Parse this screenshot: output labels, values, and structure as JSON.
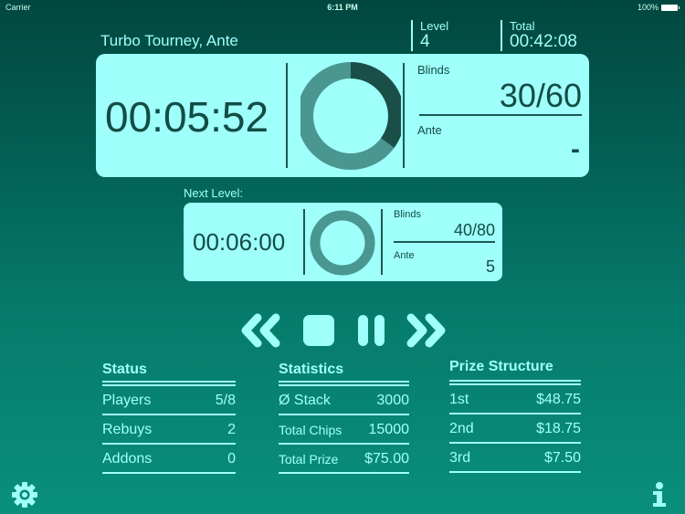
{
  "statusbar": {
    "carrier": "Carrier",
    "time": "6:11 PM",
    "battery": "100%"
  },
  "header": {
    "title": "Turbo Tourney, Ante",
    "level_label": "Level",
    "level_value": "4",
    "total_label": "Total",
    "total_value": "00:42:08"
  },
  "current": {
    "timer": "00:05:52",
    "progress_elapsed": 0.35,
    "blinds_label": "Blinds",
    "blinds_value": "30/60",
    "ante_label": "Ante",
    "ante_value": "-"
  },
  "next": {
    "label": "Next Level:",
    "timer": "00:06:00",
    "progress_elapsed": 0,
    "blinds_label": "Blinds",
    "blinds_value": "40/80",
    "ante_label": "Ante",
    "ante_value": "5"
  },
  "controls": {
    "rewind": "rewind-icon",
    "stop": "stop-icon",
    "pause": "pause-icon",
    "forward": "fast-forward-icon"
  },
  "status": {
    "title": "Status",
    "rows": [
      {
        "label": "Players",
        "value": "5/8"
      },
      {
        "label": "Rebuys",
        "value": "2"
      },
      {
        "label": "Addons",
        "value": "0"
      }
    ]
  },
  "statistics": {
    "title": "Statistics",
    "rows": [
      {
        "label": "Ø Stack",
        "value": "3000"
      },
      {
        "label": "Total Chips",
        "value": "15000"
      },
      {
        "label": "Total Prize",
        "value": "$75.00"
      }
    ]
  },
  "prize": {
    "title": "Prize Structure",
    "rows": [
      {
        "label": "1st",
        "value": "$48.75"
      },
      {
        "label": "2nd",
        "value": "$18.75"
      },
      {
        "label": "3rd",
        "value": "$7.50"
      }
    ]
  },
  "colors": {
    "accent": "#9ffffb",
    "dark": "#124d45",
    "ring_track": "#4a9690",
    "ring_fill": "#1a4f48"
  }
}
